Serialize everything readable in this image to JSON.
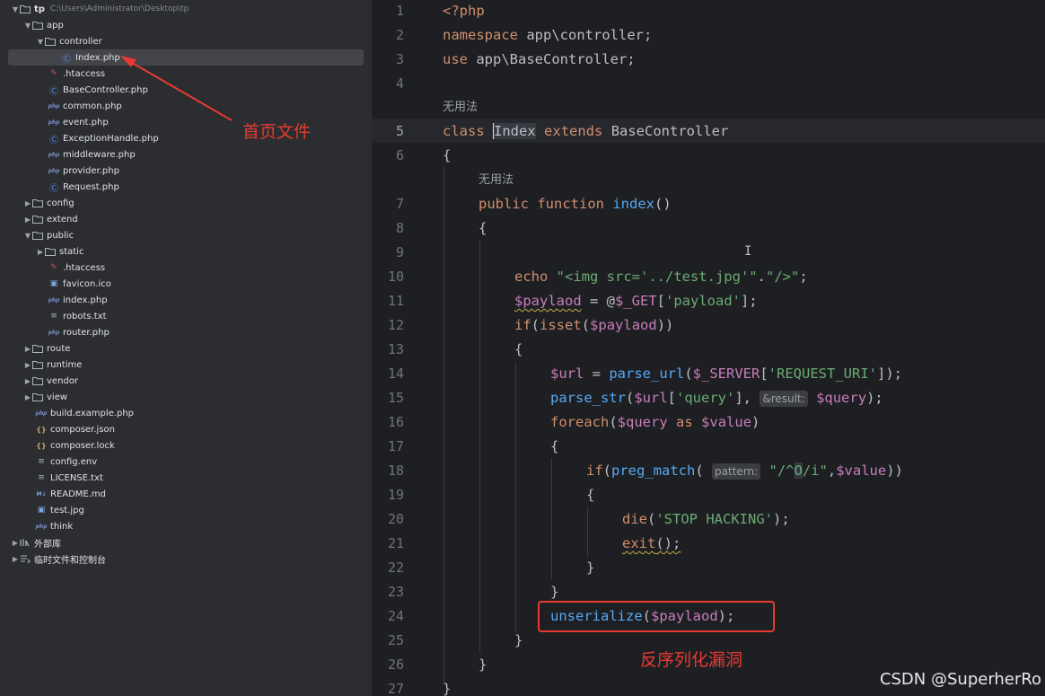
{
  "sidebar": {
    "root": {
      "name": "tp",
      "path": "C:\\Users\\Administrator\\Desktop\\tp"
    },
    "app": "app",
    "controller": "controller",
    "controller_index": "Index.php",
    "app_files": [
      ".htaccess",
      "BaseController.php",
      "common.php",
      "event.php",
      "ExceptionHandle.php",
      "middleware.php",
      "provider.php",
      "Request.php"
    ],
    "config": "config",
    "extend": "extend",
    "public": "public",
    "static": "static",
    "public_files": [
      ".htaccess",
      "favicon.ico",
      "index.php",
      "robots.txt",
      "router.php"
    ],
    "dirs": [
      "route",
      "runtime",
      "vendor",
      "view"
    ],
    "root_files": [
      "build.example.php",
      "composer.json",
      "composer.lock",
      "config.env",
      "LICENSE.txt",
      "README.md",
      "test.jpg",
      "think"
    ],
    "external_libs": "外部库",
    "scratches": "临时文件和控制台"
  },
  "editor": {
    "line_numbers": [
      "1",
      "2",
      "3",
      "4",
      "5",
      "6",
      "7",
      "8",
      "9",
      "10",
      "11",
      "12",
      "13",
      "14",
      "15",
      "16",
      "17",
      "18",
      "19",
      "20",
      "21",
      "22",
      "23",
      "24",
      "25",
      "26",
      "27"
    ],
    "no_usages": "无用法",
    "tokens": {
      "php_open": "<?php",
      "namespace_kw": "namespace",
      "namespace_val": " app\\controller;",
      "use_kw": "use",
      "use_val": " app\\BaseController;",
      "class_kw": "class",
      "class_name": "Index",
      "extends_kw": "extends",
      "base_class": " BaseController",
      "brace_open": "{",
      "brace_close": "}",
      "public_kw": "public",
      "function_kw": "function",
      "method_name": "index",
      "parens": "()",
      "echo_kw": "echo",
      "echo_str1": "\"<img src='../test.jpg'\"",
      "dot": ".",
      "echo_str2": "\"/>\"",
      "semi": ";",
      "var_paylaod": "$paylaod",
      "assign_at": " = @",
      "var_get": "$_GET",
      "lbracket": "[",
      "str_payload": "'payload'",
      "rbracket_semi": "];",
      "if_kw": "if",
      "lparen": "(",
      "isset_fn": "isset",
      "rparen2": "))",
      "var_url": "$url",
      "assign": " = ",
      "parse_url_fn": "parse_url",
      "var_server": "$_SERVER",
      "str_request_uri": "'REQUEST_URI'",
      "close_call": "]);",
      "parse_str_fn": "parse_str",
      "str_query": "'query'",
      "comma": "],",
      "hint_result": "&result:",
      "var_query": "$query",
      "close_paren_semi": ");",
      "foreach_kw": "foreach",
      "as_kw": "as",
      "var_value": "$value",
      "rparen": ")",
      "preg_match_fn": "preg_match",
      "hint_pattern": "pattern:",
      "str_pattern_a": "\"/^",
      "str_pattern_b": "O",
      "str_pattern_c": "/i\"",
      "comma_only": ",",
      "die_fn": "die",
      "str_stop": "'STOP HACKING'",
      "exit_fn": "exit",
      "call_semi": "();",
      "unserialize_fn": "unserialize"
    }
  },
  "annotations": {
    "home_file": "首页文件",
    "vuln": "反序列化漏洞"
  },
  "watermark": "CSDN @SuperherRo",
  "cursor_glyph": "I",
  "colors": {
    "accent": "#e93a32",
    "keyword": "#cf8e6d",
    "function": "#56a8f5",
    "variable": "#c77dbb",
    "string": "#6aab73"
  }
}
